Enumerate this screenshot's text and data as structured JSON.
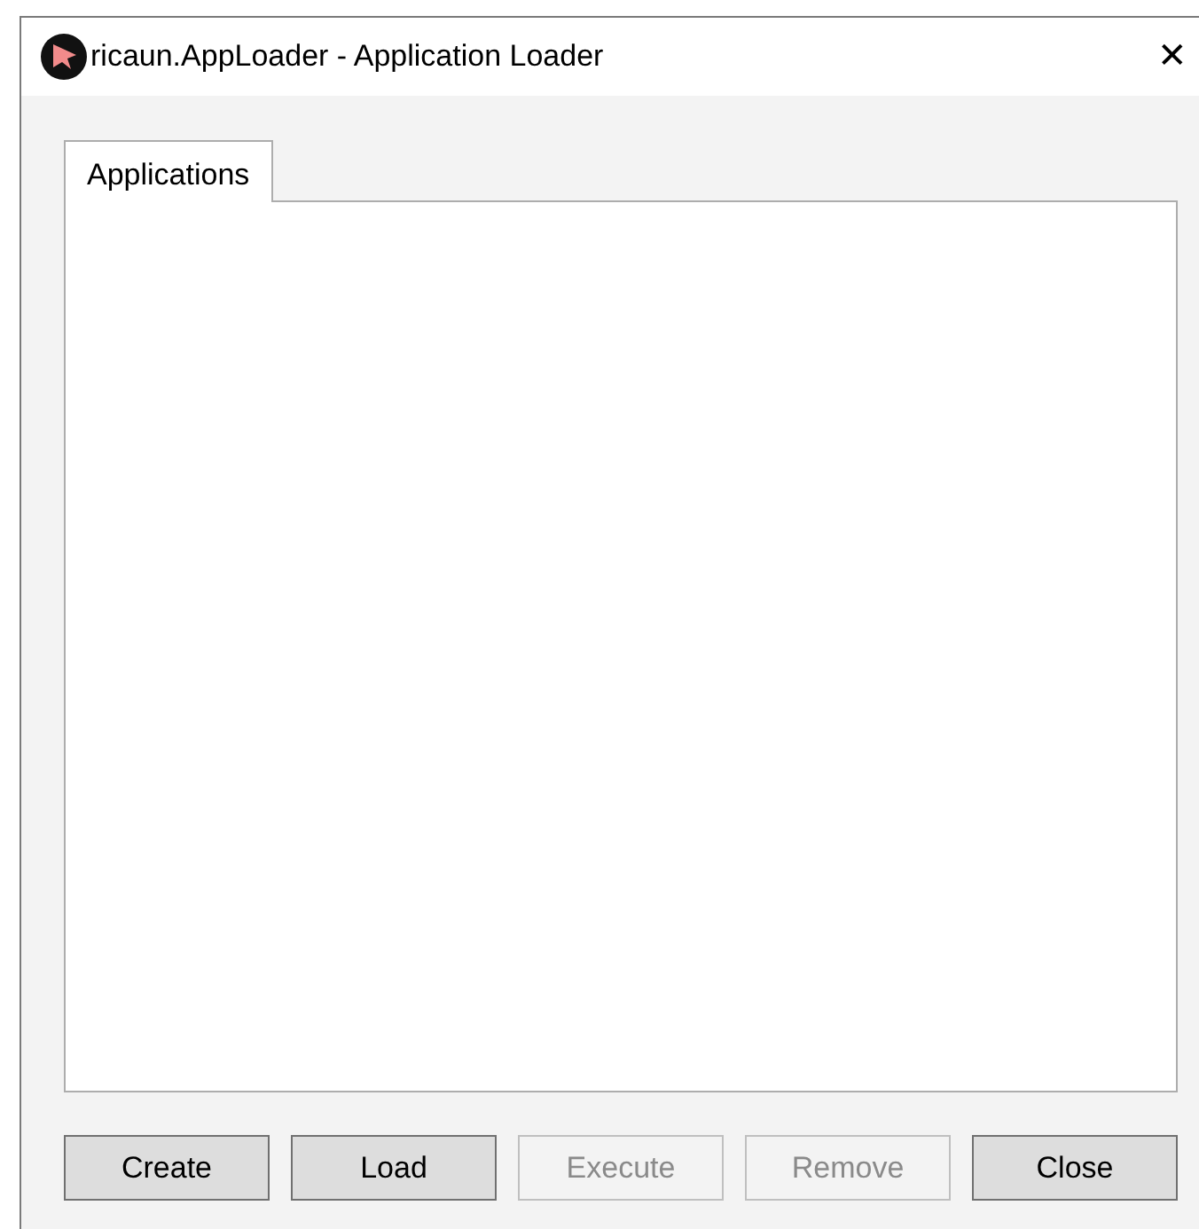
{
  "window": {
    "title": "ricaun.AppLoader - Application Loader",
    "close": "✕"
  },
  "tabs": [
    {
      "label": "Applications",
      "selected": true
    }
  ],
  "buttons": [
    {
      "label": "Create",
      "disabled": false
    },
    {
      "label": "Load",
      "disabled": false
    },
    {
      "label": "Execute",
      "disabled": true
    },
    {
      "label": "Remove",
      "disabled": true
    },
    {
      "label": "Close",
      "disabled": false
    }
  ]
}
